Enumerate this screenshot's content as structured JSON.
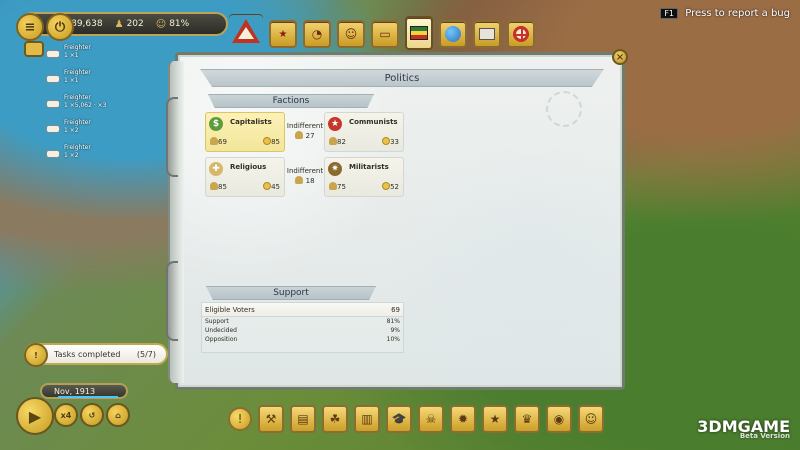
{
  "hud": {
    "money": "189,638",
    "population": "202",
    "approval": "81%"
  },
  "report": {
    "key": "F1",
    "label": "Press to report a bug"
  },
  "sidebar_entries": [
    {
      "title": "Freighter",
      "line": "1 ×1"
    },
    {
      "title": "Freighter",
      "line": "1 ×1"
    },
    {
      "title": "Freighter",
      "line": "1 ×5,062 · ×3"
    },
    {
      "title": "Freighter",
      "line": "1 ×2"
    },
    {
      "title": "Freighter",
      "line": "1 ×2"
    }
  ],
  "politics": {
    "title": "Politics",
    "factions_title": "Factions",
    "factions": [
      {
        "name": "Capitalists",
        "members": "69",
        "approval": "85",
        "icon": "dollar-icon",
        "icon_color": "#5e9c3a"
      },
      {
        "name": "Communists",
        "members": "82",
        "approval": "33",
        "icon": "star-icon",
        "icon_color": "#c7362b"
      },
      {
        "name": "Religious",
        "members": "85",
        "approval": "45",
        "icon": "cross-icon",
        "icon_color": "#d7b86b"
      },
      {
        "name": "Militarists",
        "members": "75",
        "approval": "52",
        "icon": "badge-icon",
        "icon_color": "#8b6a2f"
      }
    ],
    "indifferent": [
      {
        "label": "Indifferent",
        "value": "27"
      },
      {
        "label": "Indifferent",
        "value": "18"
      }
    ],
    "support_title": "Support",
    "eligible_label": "Eligible Voters",
    "eligible_value": "69",
    "support_rows": [
      {
        "label": "Support",
        "value": "81%"
      },
      {
        "label": "Undecided",
        "value": "9%"
      },
      {
        "label": "Opposition",
        "value": "10%"
      }
    ]
  },
  "tasks": {
    "label": "Tasks completed",
    "count": "(5/7)"
  },
  "time": {
    "date": "Nov, 1913",
    "speed_1": "x4",
    "speed_2": "↺",
    "speed_3": "⌂"
  },
  "top_tabs": [
    "triangle-warning",
    "faction",
    "economy",
    "people",
    "construction",
    "politics",
    "world",
    "edicts",
    "target"
  ],
  "bottom_toolbar": [
    "alert",
    "tools",
    "docs",
    "nature",
    "book",
    "education",
    "pirate",
    "wheel",
    "star",
    "suit",
    "seal",
    "sailor"
  ],
  "watermark": {
    "main": "3DMGAME",
    "sub": "Beta Version"
  }
}
